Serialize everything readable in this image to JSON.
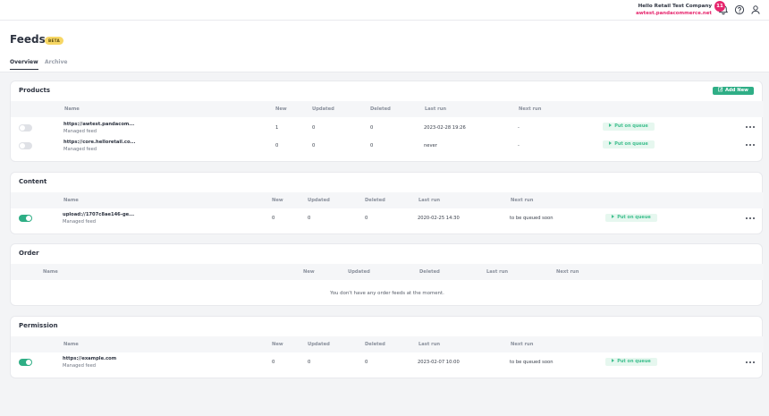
{
  "topbar": {
    "company_name": "Hello Retail Test Company",
    "company_domain": "awtest.pandacommerce.net",
    "notification_count": "11",
    "icons": [
      "bell-icon",
      "help-icon",
      "user-icon"
    ]
  },
  "header": {
    "title": "Feeds",
    "badge": "BETA",
    "tabs": [
      {
        "label": "Overview",
        "active": true
      },
      {
        "label": "Archive",
        "active": false
      }
    ]
  },
  "colors": {
    "accent": "#2fae86",
    "brand_pink": "#e6266d",
    "queue_text": "#3fbf8e",
    "beta_badge": "#f7d765"
  },
  "sections": {
    "products": {
      "title": "Products",
      "add_button": "Add New",
      "columns": [
        "Name",
        "New",
        "Updated",
        "Deleted",
        "Last run",
        "Next run"
      ],
      "rows": [
        {
          "enabled": false,
          "url": "https://awtest.pandacom...",
          "type": "Managed feed",
          "new": "1",
          "updated": "0",
          "deleted": "0",
          "last_run": "2023-02-28 19:26",
          "next_run": "-",
          "action": "Put on queue"
        },
        {
          "enabled": false,
          "url": "https://core.helloretail.co...",
          "type": "Managed feed",
          "new": "0",
          "updated": "0",
          "deleted": "0",
          "last_run": "never",
          "next_run": "-",
          "action": "Put on queue"
        }
      ]
    },
    "content": {
      "title": "Content",
      "columns": [
        "Name",
        "New",
        "Updated",
        "Deleted",
        "Last run",
        "Next run"
      ],
      "rows": [
        {
          "enabled": true,
          "url": "upload://1707c8ae146-ge...",
          "type": "Managed feed",
          "new": "0",
          "updated": "0",
          "deleted": "0",
          "last_run": "2020-02-25 14:30",
          "next_run": "to be queued soon",
          "action": "Put on queue"
        }
      ]
    },
    "order": {
      "title": "Order",
      "columns": [
        "Name",
        "New",
        "Updated",
        "Deleted",
        "Last run",
        "Next run"
      ],
      "empty_message": "You don't have any order feeds at the moment."
    },
    "permission": {
      "title": "Permission",
      "columns": [
        "Name",
        "New",
        "Updated",
        "Deleted",
        "Last run",
        "Next run"
      ],
      "rows": [
        {
          "enabled": true,
          "url": "https://example.com",
          "type": "Managed feed",
          "new": "0",
          "updated": "0",
          "deleted": "0",
          "last_run": "2023-02-07 10:00",
          "next_run": "to be queued soon",
          "action": "Put on queue"
        }
      ]
    }
  }
}
